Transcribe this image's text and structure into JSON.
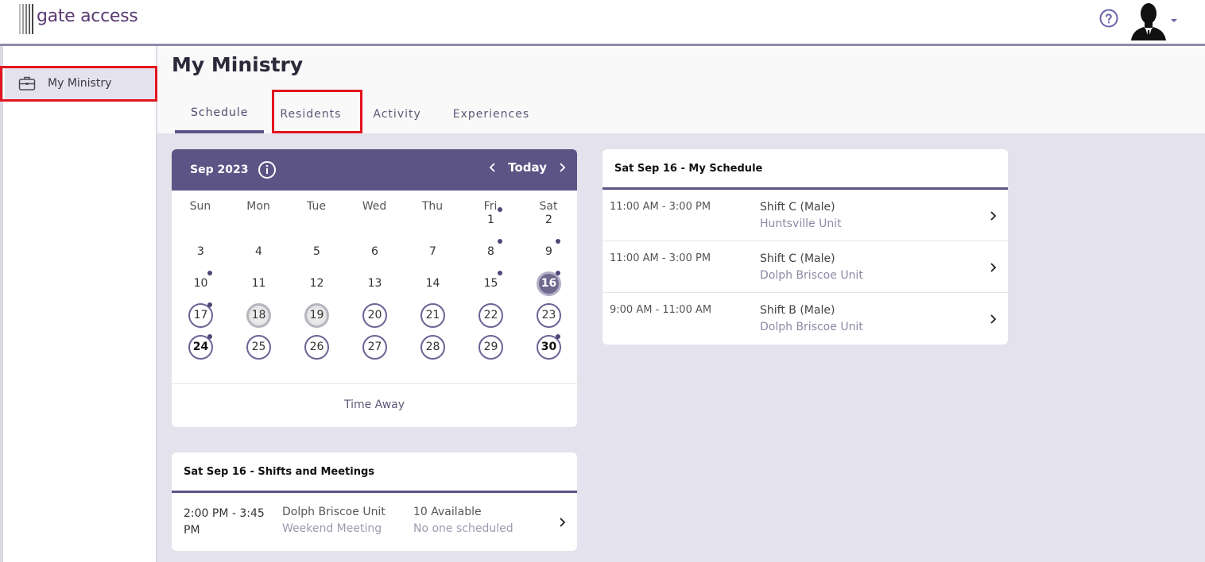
{
  "header": {
    "logo_text": "gate access",
    "logo_bar_colors": [
      "#bdbdbd",
      "#9e9e9e",
      "#7d7d7d",
      "#5e5e5e",
      "#444444"
    ],
    "help_icon": "help-circle-icon",
    "avatar_icon": "user-silhouette-icon",
    "brand_color": "#5b3a72"
  },
  "sidebar": {
    "items": [
      {
        "label": "My Ministry",
        "icon": "briefcase-icon",
        "active": true
      }
    ]
  },
  "main": {
    "title": "My Ministry",
    "tabs": [
      {
        "label": "Schedule",
        "active": true
      },
      {
        "label": "Residents",
        "active": false
      },
      {
        "label": "Activity",
        "active": false
      },
      {
        "label": "Experiences",
        "active": false
      }
    ]
  },
  "calendar": {
    "month_label": "Sep 2023",
    "today_label": "Today",
    "weekdays": [
      "Sun",
      "Mon",
      "Tue",
      "Wed",
      "Thu",
      "Fri",
      "Sat"
    ],
    "first_weekday_index": 5,
    "days_in_month": 30,
    "selected_day": 16,
    "dotted_days": [
      1,
      8,
      9,
      10,
      15,
      16,
      17,
      24,
      30
    ],
    "ringed_days": [
      17,
      20,
      21,
      22,
      23,
      24,
      25,
      26,
      27,
      28,
      29,
      30
    ],
    "grey_days": [
      18,
      19
    ],
    "bold_days": [
      24,
      30
    ],
    "time_away_label": "Time Away",
    "accent_color": "#5b5485"
  },
  "my_schedule": {
    "title": "Sat Sep 16 - My Schedule",
    "rows": [
      {
        "time": "11:00 AM - 3:00 PM",
        "shift": "Shift C (Male)",
        "unit": "Huntsville Unit"
      },
      {
        "time": "11:00 AM - 3:00 PM",
        "shift": "Shift C (Male)",
        "unit": "Dolph Briscoe Unit"
      },
      {
        "time": "9:00 AM - 11:00 AM",
        "shift": "Shift B (Male)",
        "unit": "Dolph Briscoe Unit"
      }
    ]
  },
  "shifts_meetings": {
    "title": "Sat Sep 16 - Shifts and Meetings",
    "rows": [
      {
        "time": "2:00 PM - 3:45 PM",
        "unit": "Dolph Briscoe Unit",
        "event": "Weekend Meeting",
        "available": "10 Available",
        "scheduled": "No one scheduled"
      }
    ]
  },
  "highlight_color": "#e3141e"
}
